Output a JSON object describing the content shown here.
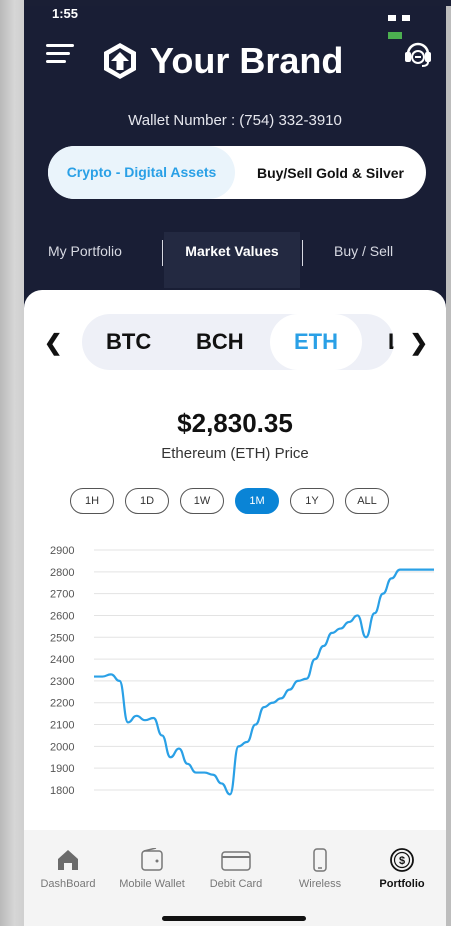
{
  "status_bar": {
    "time": "1:55"
  },
  "header": {
    "menu_icon": "hamburger-menu-icon",
    "brand_name": "Your Brand",
    "brand_logo": "brand-logo-icon",
    "support_icon": "headset-support-icon",
    "wallet_number": "Wallet Number : (754) 332-3910"
  },
  "segment": {
    "options": [
      "Crypto - Digital Assets",
      "Buy/Sell Gold & Silver"
    ],
    "selected": "Crypto - Digital Assets"
  },
  "tabs": {
    "items": [
      "My Portfolio",
      "Market Values",
      "Buy / Sell"
    ],
    "selected": "Market Values"
  },
  "coin_selector": {
    "prev_icon": "chevron-left-icon",
    "next_icon": "chevron-right-icon",
    "coins": [
      "BTC",
      "BCH",
      "ETH",
      "L"
    ],
    "selected": "ETH"
  },
  "price": {
    "value": "$2,830.35",
    "label": "Ethereum (ETH) Price"
  },
  "time_ranges": {
    "options": [
      "1H",
      "1D",
      "1W",
      "1M",
      "1Y",
      "ALL"
    ],
    "selected": "1M"
  },
  "chart_data": {
    "type": "line",
    "title": "",
    "xlabel": "",
    "ylabel": "",
    "ylim": [
      1800,
      2900
    ],
    "y_ticks": [
      2900,
      2800,
      2700,
      2600,
      2500,
      2400,
      2300,
      2200,
      2100,
      2000,
      1900,
      1800
    ],
    "grid": true,
    "line_color": "#2aa0e6",
    "x": [
      0,
      1,
      2,
      3,
      4,
      5,
      6,
      7,
      8,
      9,
      10,
      11,
      12,
      13,
      14,
      15,
      16,
      17,
      18,
      19,
      20,
      21,
      22,
      23,
      24,
      25,
      26,
      27,
      28,
      29,
      30,
      31,
      32,
      33,
      34,
      35,
      36,
      37,
      38,
      39,
      40
    ],
    "values": [
      2320,
      2320,
      2330,
      2300,
      2110,
      2140,
      2120,
      2130,
      2050,
      1950,
      1990,
      1920,
      1880,
      1880,
      1870,
      1830,
      1780,
      2000,
      2020,
      2100,
      2180,
      2200,
      2220,
      2260,
      2300,
      2310,
      2400,
      2460,
      2520,
      2540,
      2570,
      2600,
      2500,
      2610,
      2700,
      2770,
      2810,
      2810,
      2810,
      2810,
      2810
    ]
  },
  "bottom_nav": {
    "items": [
      {
        "label": "DashBoard",
        "icon": "home-icon"
      },
      {
        "label": "Mobile Wallet",
        "icon": "wallet-icon"
      },
      {
        "label": "Debit Card",
        "icon": "credit-card-icon"
      },
      {
        "label": "Wireless",
        "icon": "phone-icon"
      },
      {
        "label": "Portfolio",
        "icon": "dollar-coin-icon"
      }
    ],
    "selected": "Portfolio"
  },
  "colors": {
    "header_bg": "#191e35",
    "accent": "#2aa0e6",
    "active_range": "#0a84d6"
  }
}
